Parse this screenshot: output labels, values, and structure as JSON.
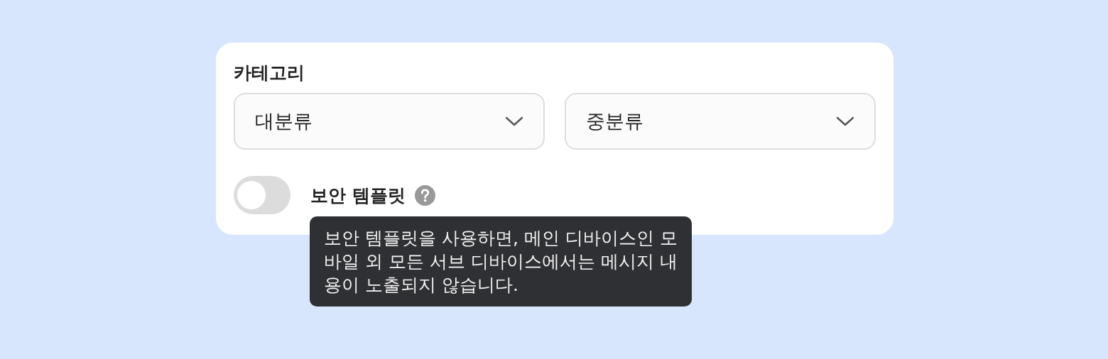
{
  "category": {
    "label": "카테고리",
    "selects": [
      {
        "value": "대분류"
      },
      {
        "value": "중분류"
      }
    ]
  },
  "secure_template": {
    "label": "보안 템플릿",
    "on": false
  },
  "tooltip": {
    "text": "보안 템플릿을 사용하면, 메인 디바이스인 모바일 외 모든 서브 디바이스에서는 메시지 내용이 노출되지 않습니다."
  }
}
